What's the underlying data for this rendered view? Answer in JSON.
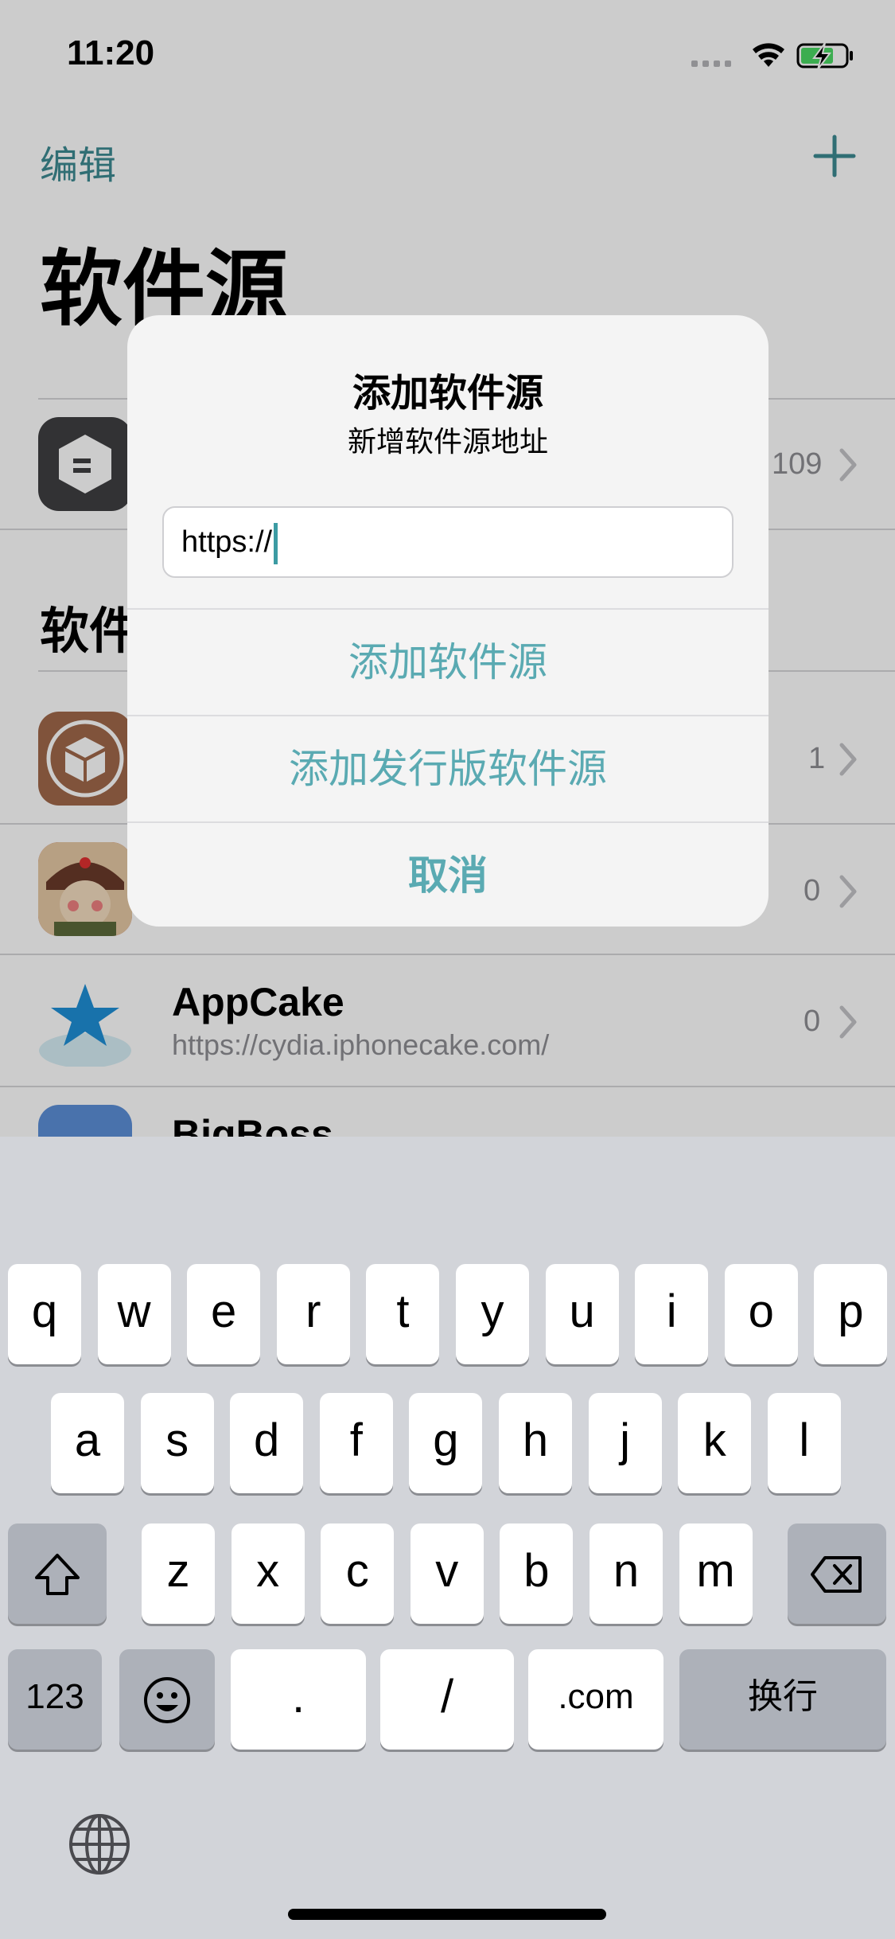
{
  "status_bar": {
    "time": "11:20"
  },
  "nav": {
    "edit_label": "编辑",
    "title": "软件源"
  },
  "featured_row": {
    "count": "109"
  },
  "section": {
    "header_visible": "软件"
  },
  "rows": [
    {
      "count": "1"
    },
    {
      "count": "0"
    },
    {
      "name": "AppCake",
      "url": "https://cydia.iphonecake.com/",
      "count": "0"
    },
    {
      "name": "BigBoss"
    }
  ],
  "alert": {
    "title": "添加软件源",
    "message": "新增软件源地址",
    "input_value": "https://",
    "add_button": "添加软件源",
    "add_dist_button": "添加发行版软件源",
    "cancel_button": "取消"
  },
  "keyboard": {
    "row1": [
      "q",
      "w",
      "e",
      "r",
      "t",
      "y",
      "u",
      "i",
      "o",
      "p"
    ],
    "row2": [
      "a",
      "s",
      "d",
      "f",
      "g",
      "h",
      "j",
      "k",
      "l"
    ],
    "row3": [
      "z",
      "x",
      "c",
      "v",
      "b",
      "n",
      "m"
    ],
    "numbers_key": "123",
    "dot_key": ".",
    "slash_key": "/",
    "dotcom_key": ".com",
    "return_key": "换行"
  },
  "colors": {
    "accent": "#5aaab2",
    "keyboard_bg": "#d2d4d9"
  }
}
